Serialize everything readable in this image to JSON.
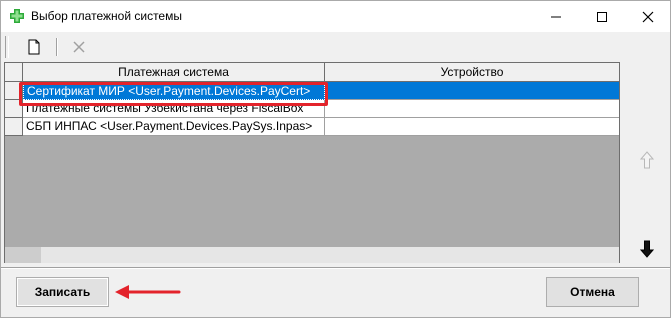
{
  "window": {
    "title": "Выбор платежной системы",
    "icon": "green-cross-icon"
  },
  "title_buttons": [
    "minimize-icon",
    "maximize-icon",
    "close-icon"
  ],
  "toolbar": {
    "new_icon": "new-document-icon",
    "delete_icon": "delete-x-icon"
  },
  "grid": {
    "columns": [
      "Платежная система",
      "Устройство"
    ],
    "rows": [
      {
        "system": "Сертификат МИР <User.Payment.Devices.PayCert>",
        "device": "",
        "selected": true
      },
      {
        "system": "Платежные системы Узбекистана через FiscalBox",
        "device": "",
        "selected": false
      },
      {
        "system": "СБП ИНПАС <User.Payment.Devices.PaySys.Inpas>",
        "device": "",
        "selected": false
      }
    ]
  },
  "nav": {
    "up_icon": "arrow-up-icon",
    "down_icon": "arrow-down-icon"
  },
  "buttons": {
    "save": "Записать",
    "cancel": "Отмена"
  },
  "colors": {
    "selection": "#0078d7",
    "annotation": "#e3232b",
    "app_icon": "#2eaa3a"
  }
}
